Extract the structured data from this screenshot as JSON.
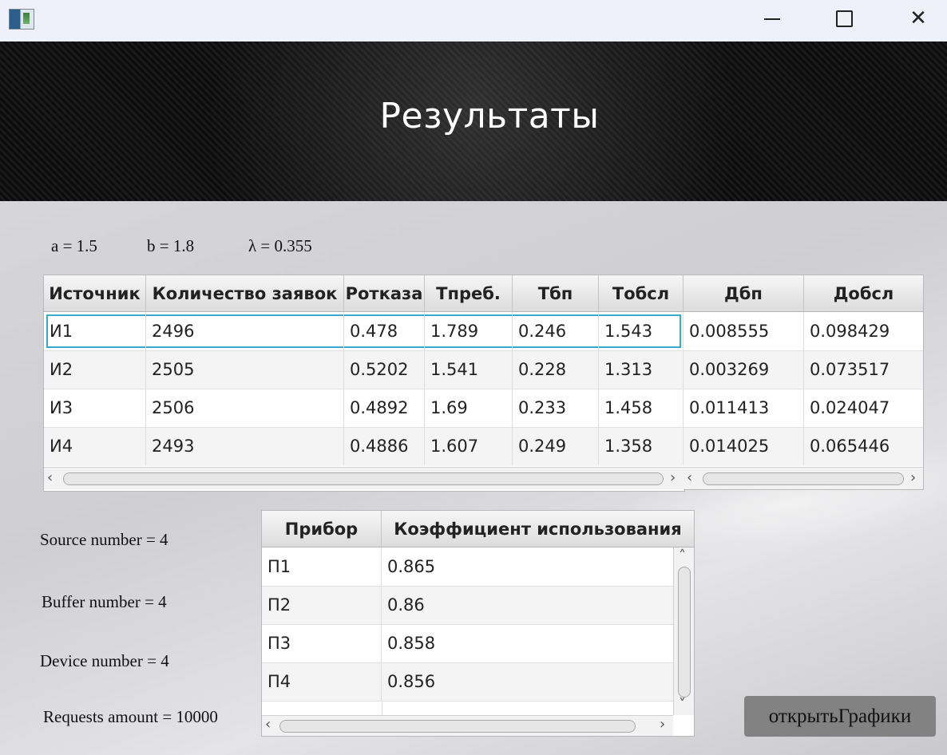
{
  "window": {
    "title_icon": "app-window-icon",
    "min_icon": "minimize-icon",
    "max_icon": "maximize-icon",
    "close_symbol": "✕"
  },
  "banner": {
    "title": "Результаты"
  },
  "params": {
    "a": "a = 1.5",
    "b": "b = 1.8",
    "lambda": "λ = 0.355"
  },
  "sources_table": {
    "headers": [
      "Источник",
      "Количество заявок",
      "Ротказа",
      "Тпреб.",
      "Тбп",
      "Тобсл"
    ],
    "rows": [
      [
        "И1",
        "2496",
        "0.478",
        "1.789",
        "0.246",
        "1.543"
      ],
      [
        "И2",
        "2505",
        "0.5202",
        "1.541",
        "0.228",
        "1.313"
      ],
      [
        "И3",
        "2506",
        "0.4892",
        "1.69",
        "0.233",
        "1.458"
      ],
      [
        "И4",
        "2493",
        "0.4886",
        "1.607",
        "0.249",
        "1.358"
      ]
    ]
  },
  "disp_table": {
    "headers": [
      "Дбп",
      "Добсл"
    ],
    "rows": [
      [
        "0.008555",
        "0.098429"
      ],
      [
        "0.003269",
        "0.073517"
      ],
      [
        "0.011413",
        "0.024047"
      ],
      [
        "0.014025",
        "0.065446"
      ]
    ]
  },
  "info": {
    "source_number": "Source number = 4",
    "buffer_number": "Buffer number = 4",
    "device_number": "Device number = 4",
    "requests_amount": "Requests amount = 10000"
  },
  "devices_table": {
    "headers": [
      "Прибор",
      "Коэффициент использования"
    ],
    "rows": [
      [
        "П1",
        "0.865"
      ],
      [
        "П2",
        "0.86"
      ],
      [
        "П3",
        "0.858"
      ],
      [
        "П4",
        "0.856"
      ]
    ]
  },
  "scroll": {
    "left": "‹",
    "right": "›",
    "up": "˄",
    "down": "˅"
  },
  "open_charts_label": "открытьГрафики"
}
